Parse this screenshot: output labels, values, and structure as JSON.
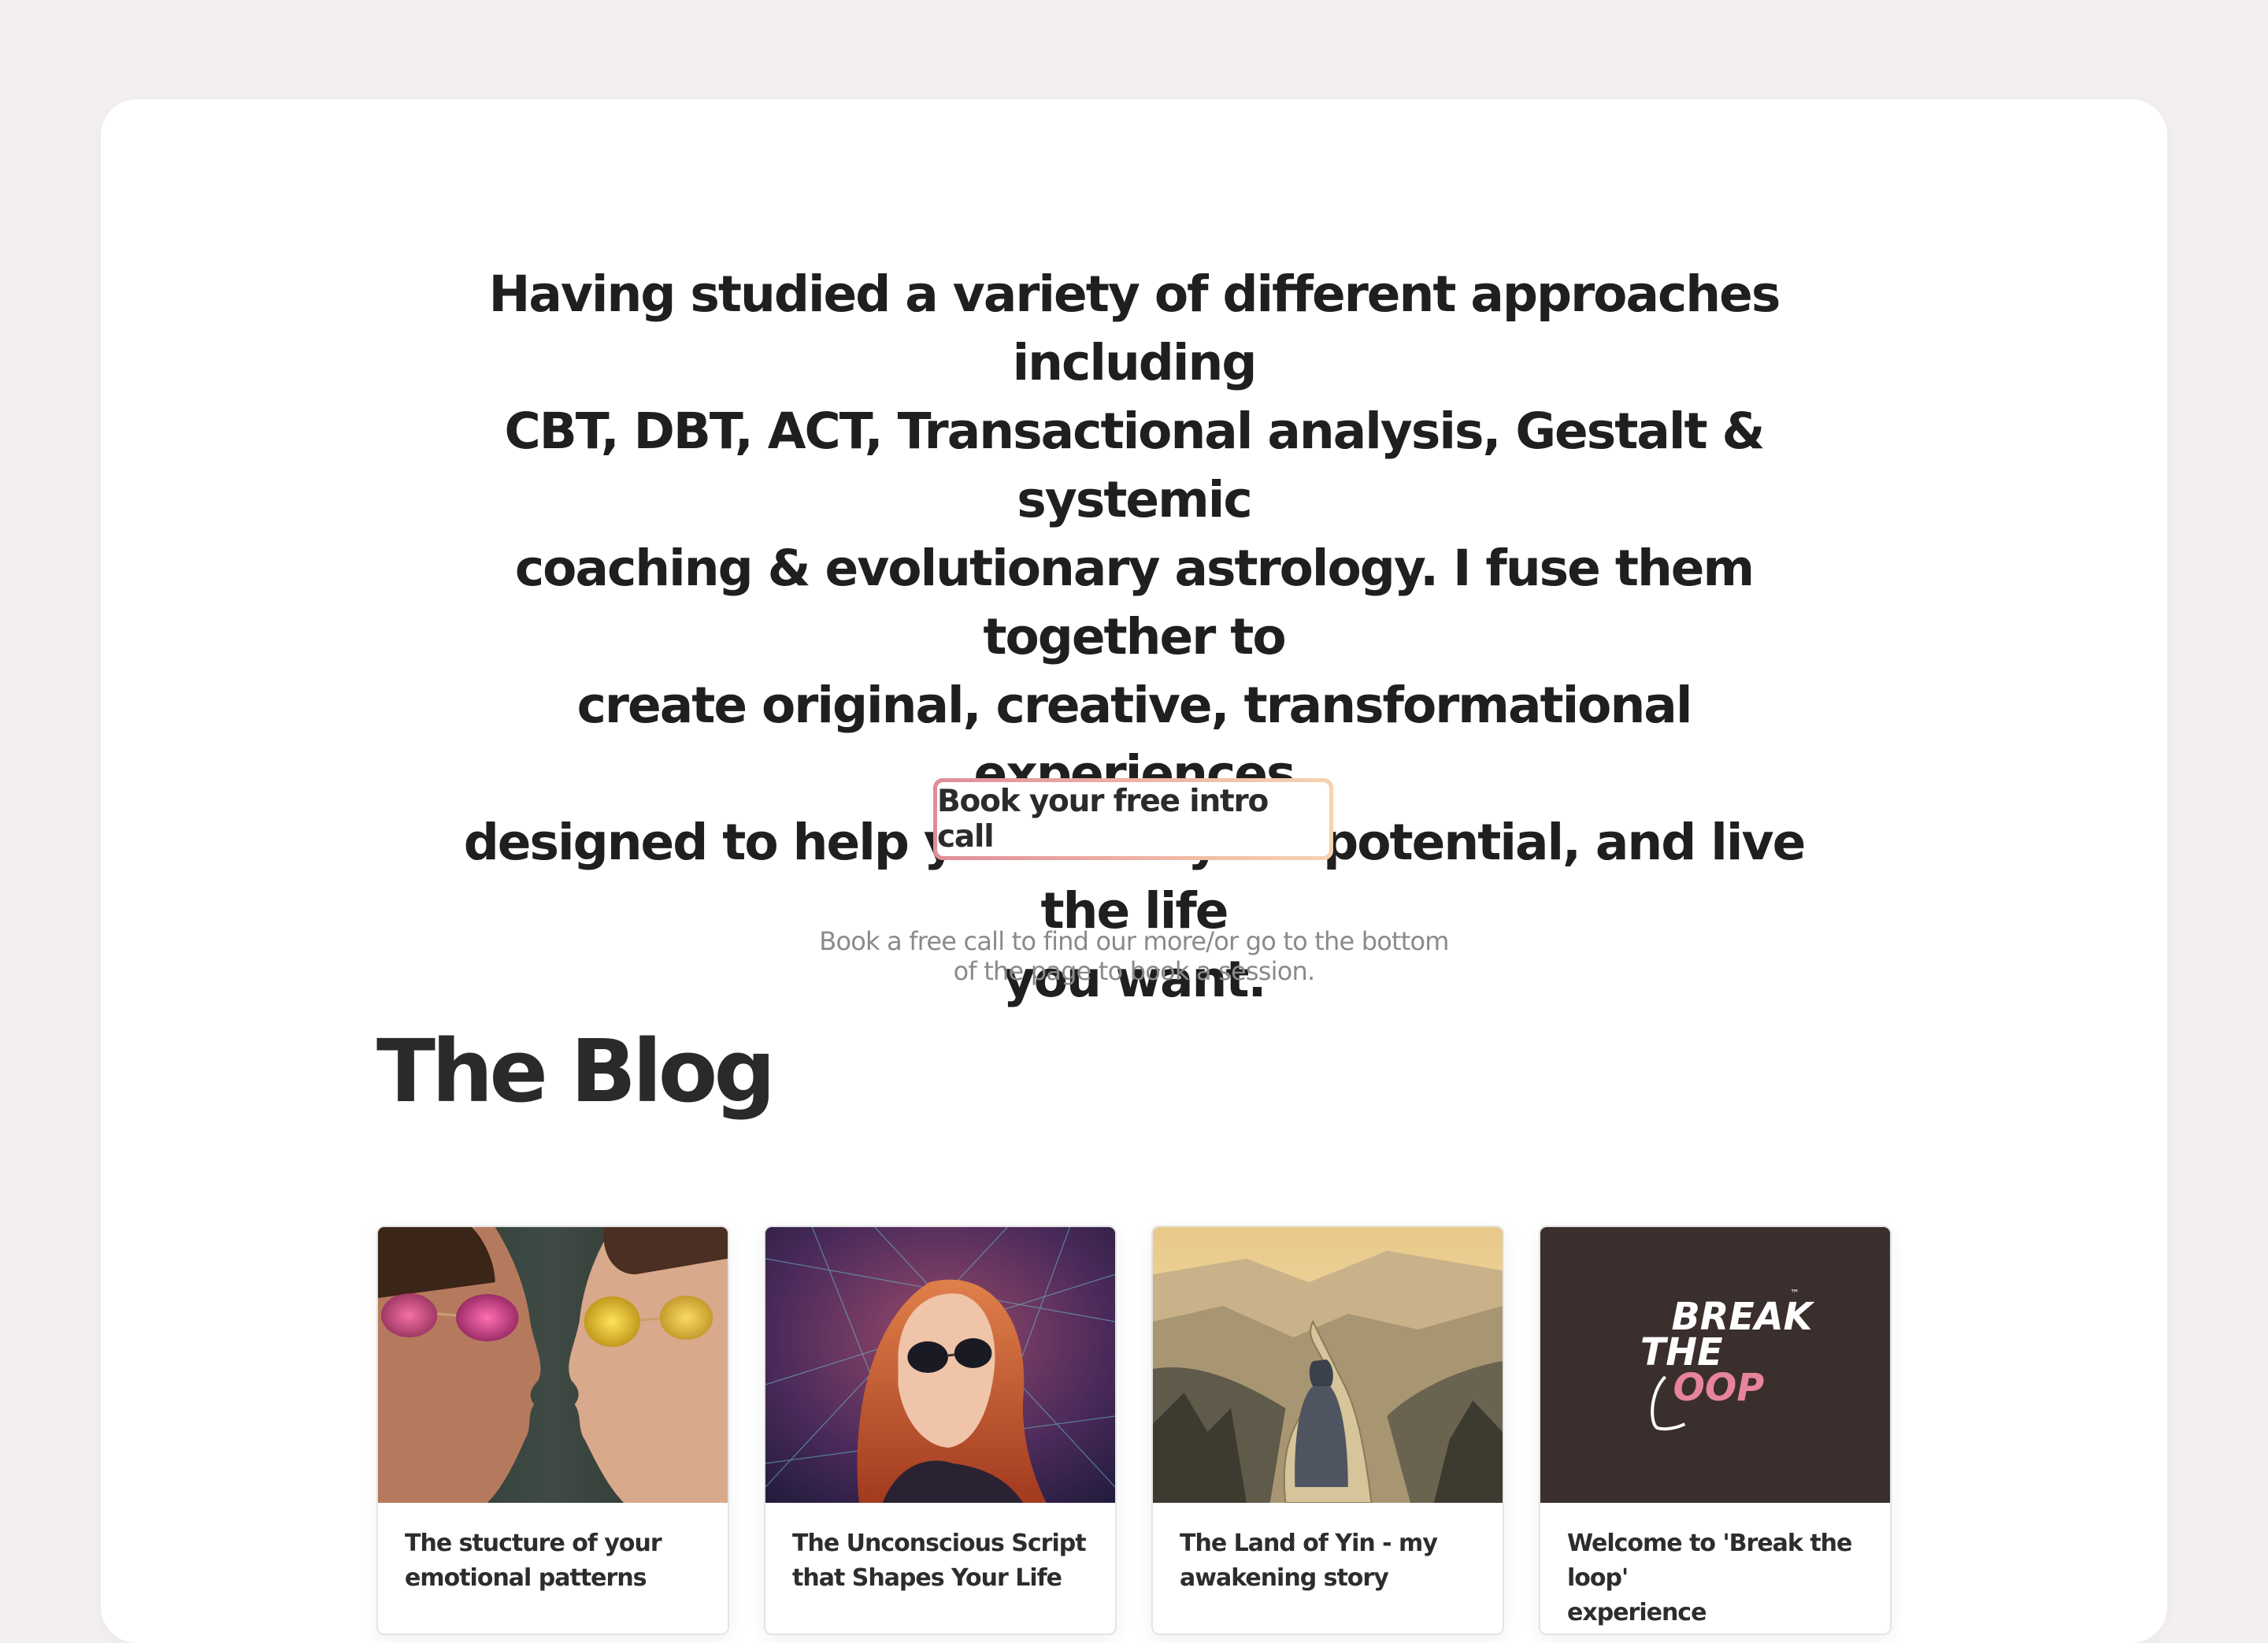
{
  "intro": {
    "lines": [
      "Having studied a variety of different approaches including",
      "CBT, DBT, ACT, Transactional analysis, Gestalt & systemic",
      "coaching & evolutionary astrology. I fuse them together to",
      "create original, creative, transformational experiences",
      "designed to help you fulfill your potential, and live the life",
      "you want."
    ]
  },
  "cta": {
    "label": "Book your free intro call"
  },
  "note": {
    "line1": "Book a free call to find our more/or go to the bottom",
    "line2": "of the page to book a session."
  },
  "blog": {
    "title": "The Blog",
    "posts": [
      {
        "title_line1": "The stucture of your",
        "title_line2": "emotional patterns",
        "image": "couple-sunglasses-image"
      },
      {
        "title_line1": "The Unconscious Script",
        "title_line2": "that Shapes Your Life",
        "image": "woman-sunglasses-web-image"
      },
      {
        "title_line1": "The Land of Yin - my",
        "title_line2": "awakening story",
        "image": "cloaked-traveler-path-image"
      },
      {
        "title_line1": "Welcome to 'Break the loop'",
        "title_line2": "experience",
        "image": "break-the-loop-logo-image"
      }
    ],
    "logo": {
      "line1": "BREAK",
      "line2": "THE",
      "line3": "OOP",
      "tm": "™"
    }
  },
  "colors": {
    "page_bg": "#f3eff0",
    "card_bg": "#ffffff",
    "cta_gradient_start": "#e08c9a",
    "cta_gradient_end": "#f6d3b0",
    "logo_bg": "#3a2f2d",
    "logo_accent": "#e7849a"
  }
}
